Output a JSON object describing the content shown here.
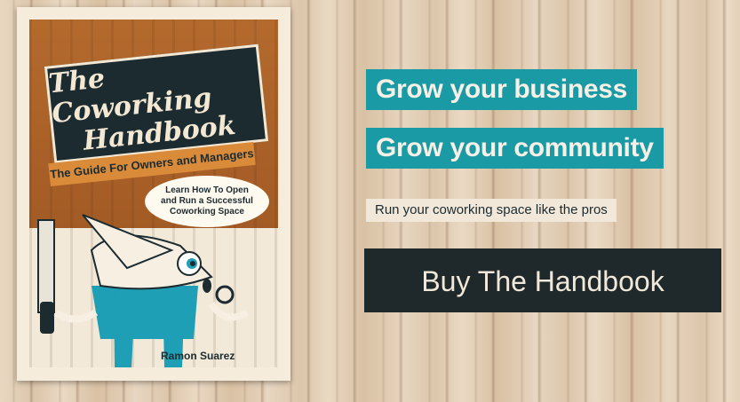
{
  "book": {
    "title_line1": "The Coworking",
    "title_line2": "Handbook",
    "subtitle": "The Guide For Owners and Managers",
    "bubble_lines": [
      "Learn How To Open",
      "and Run a Successful",
      "Coworking Space"
    ],
    "author": "Ramon Suarez"
  },
  "headlines": [
    "Grow your business",
    "Grow your community"
  ],
  "tagline": "Run your coworking space like the pros",
  "cta_label": "Buy The Handbook",
  "colors": {
    "teal": "#1a9aa5",
    "dark": "#1f292c",
    "cream": "#f1e8da",
    "wood_brown": "#a35b25"
  }
}
